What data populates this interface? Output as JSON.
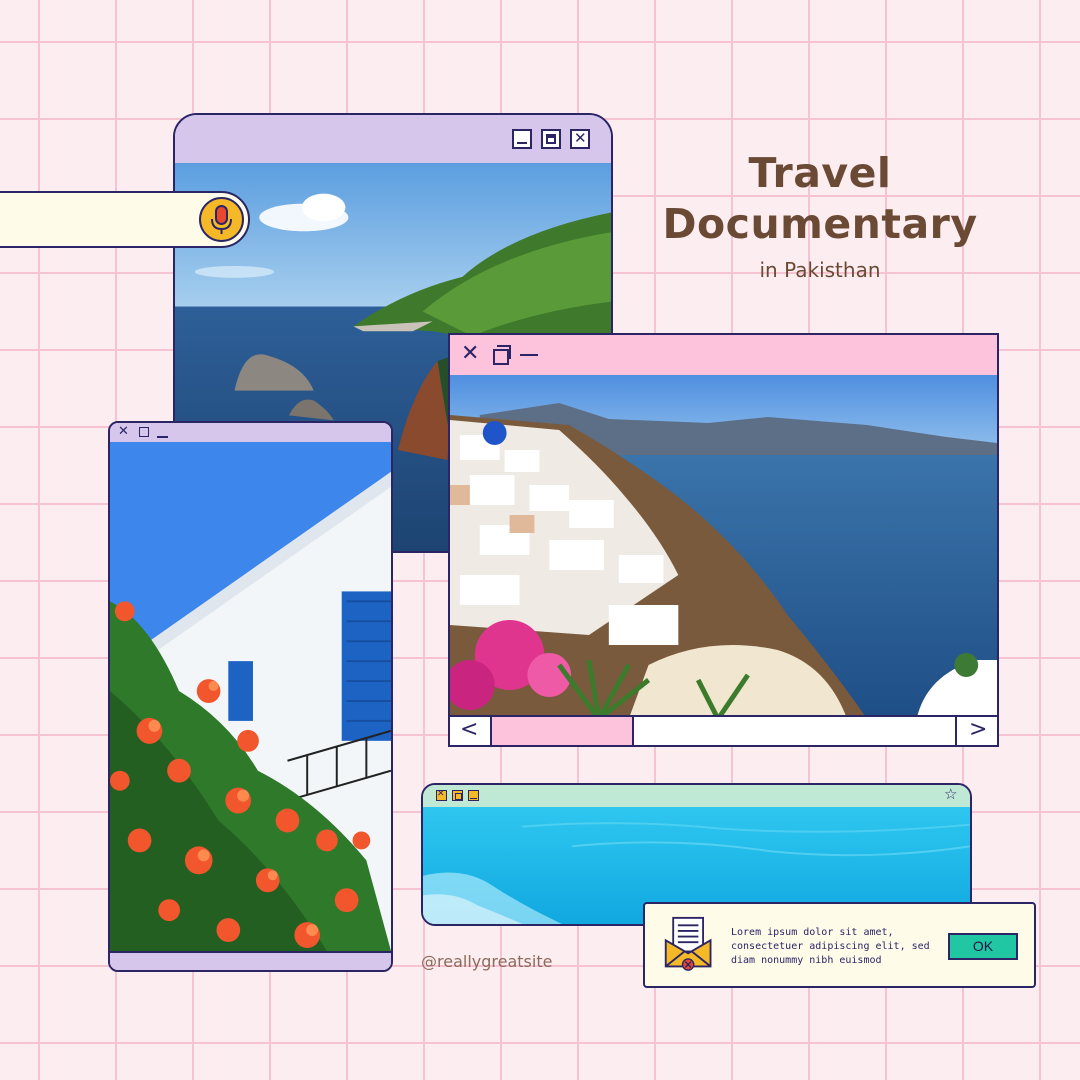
{
  "title": {
    "line1": "Travel",
    "line2": "Documentary",
    "subtitle": "in Pakisthan"
  },
  "handle": "@reallygreatsite",
  "dialog": {
    "message": "Lorem ipsum dolor sit amet, consectetuer adipiscing elit, sed diam nonummy nibh euismod",
    "ok_label": "OK"
  },
  "windows": {
    "coastal_cliffs": {
      "bar_color": "#d6c6ec",
      "controls": [
        "minimize-icon",
        "maximize-icon",
        "close-icon"
      ]
    },
    "white_house": {
      "bar_color": "#d6c6ec",
      "controls": [
        "close-icon",
        "maximize-icon",
        "minimize-icon"
      ]
    },
    "santorini": {
      "bar_color": "#fdc3dd",
      "controls": [
        "close-icon",
        "restore-icon",
        "minimize-icon"
      ],
      "scroll_prev": "<",
      "scroll_next": ">",
      "scroll_position": 0.28
    },
    "turquoise_water": {
      "bar_color": "#bfe9d4",
      "controls": [
        "close-icon",
        "maximize-icon",
        "minimize-icon",
        "star-icon"
      ]
    }
  },
  "search": {
    "icon": "microphone-icon"
  },
  "colors": {
    "background": "#fcedf1",
    "grid": "#f6c3d2",
    "outline": "#2b2566",
    "title": "#6b4a35",
    "ok_button": "#21c7a3",
    "mic": "#f5b928"
  }
}
